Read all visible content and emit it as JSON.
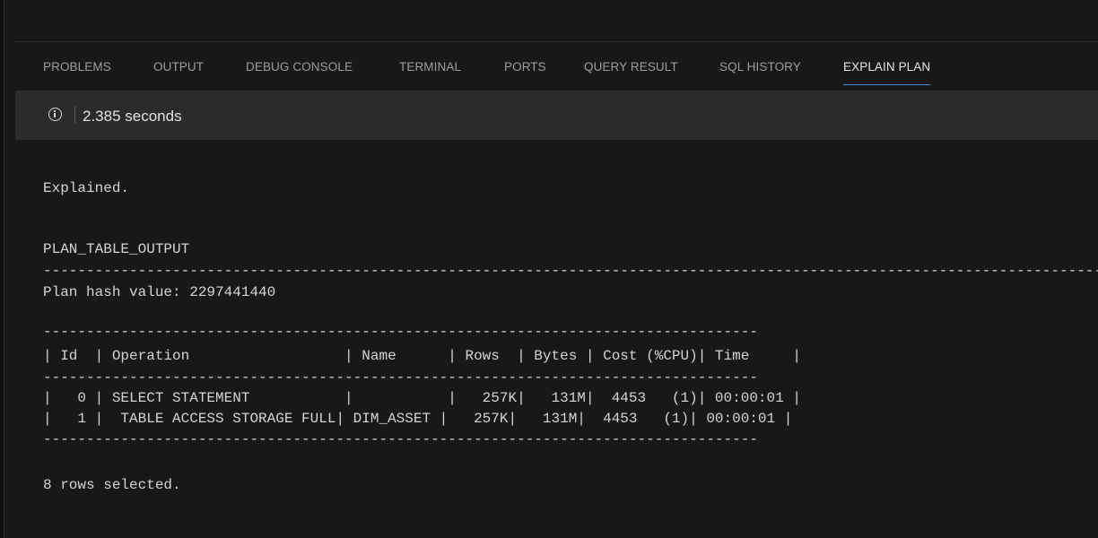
{
  "tabs": [
    {
      "label": "PROBLEMS",
      "active": false
    },
    {
      "label": "OUTPUT",
      "active": false
    },
    {
      "label": "DEBUG CONSOLE",
      "active": false
    },
    {
      "label": "TERMINAL",
      "active": false
    },
    {
      "label": "PORTS",
      "active": false
    },
    {
      "label": "QUERY RESULT",
      "active": false
    },
    {
      "label": "SQL HISTORY",
      "active": false
    },
    {
      "label": "EXPLAIN PLAN",
      "active": true
    }
  ],
  "status": {
    "icon": "info-icon",
    "elapsed": "2.385 seconds"
  },
  "output": {
    "explained": "Explained.",
    "plan_table_header": "PLAN_TABLE_OUTPUT",
    "separator_long": "------------------------------------------------------------------------------------------------------------------------------------------------------",
    "plan_hash": "Plan hash value: 2297441440",
    "separator_table": "-----------------------------------------------------------------------------------",
    "table_header": "| Id  | Operation                  | Name      | Rows  | Bytes | Cost (%CPU)| Time     |",
    "rows": [
      "|   0 | SELECT STATEMENT           |           |   257K|   131M|  4453   (1)| 00:00:01 |",
      "|   1 |  TABLE ACCESS STORAGE FULL| DIM_ASSET |   257K|   131M|  4453   (1)| 00:00:01 |"
    ],
    "rows_selected": "8 rows selected."
  },
  "colors": {
    "background": "#181818",
    "status_bar": "#2b2b2b",
    "active_tab_underline": "#3c8fd6",
    "text": "#d4d4d4",
    "tab_inactive": "#9d9d9d",
    "tab_active": "#e7e7e7"
  }
}
